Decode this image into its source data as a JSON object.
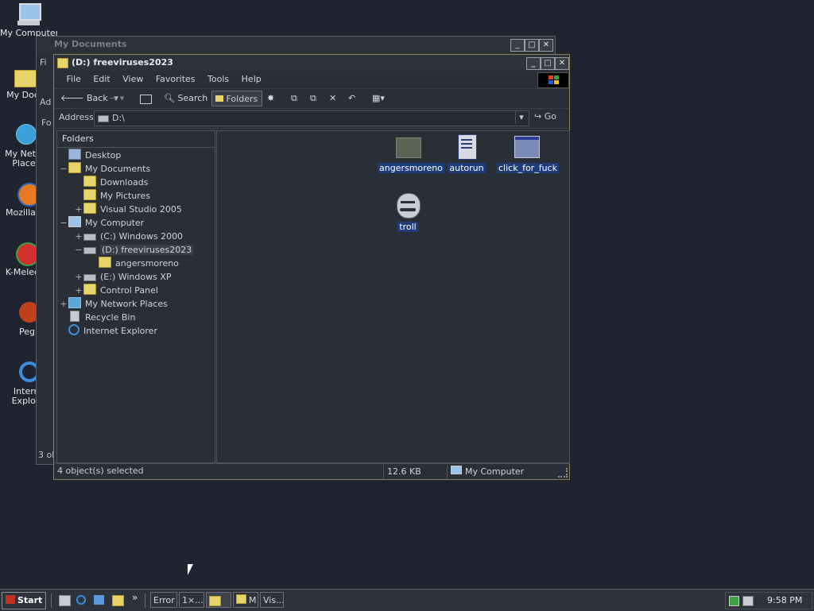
{
  "desktop": {
    "icons": [
      {
        "label": "My Computer"
      },
      {
        "label": "My Docu"
      },
      {
        "label": "My Netw"
      },
      {
        "label": "Place"
      },
      {
        "label": "Mozilla Fi"
      },
      {
        "label": "K-Melec"
      },
      {
        "label": "Peg"
      },
      {
        "label": "Interr"
      },
      {
        "label": "Explor"
      }
    ]
  },
  "bg_window": {
    "title": "My Documents",
    "fragments": [
      "Fi",
      "Ad",
      "Fo",
      "3 ol"
    ]
  },
  "window": {
    "title": "(D:) freeviruses2023",
    "menu": [
      "File",
      "Edit",
      "View",
      "Favorites",
      "Tools",
      "Help"
    ],
    "toolbar": {
      "back": "Back",
      "search": "Search",
      "folders": "Folders"
    },
    "address": {
      "label": "Address",
      "value": "D:\\",
      "go": "Go"
    },
    "folders_header": "Folders",
    "tree": [
      {
        "label": "Desktop",
        "exp": ""
      },
      {
        "label": "My Documents",
        "exp": "−"
      },
      {
        "label": "Downloads",
        "exp": ""
      },
      {
        "label": "My Pictures",
        "exp": ""
      },
      {
        "label": "Visual Studio 2005",
        "exp": "+"
      },
      {
        "label": "My Computer",
        "exp": "−"
      },
      {
        "label": "(C:) Windows 2000",
        "exp": "+"
      },
      {
        "label": "(D:) freeviruses2023",
        "exp": "−"
      },
      {
        "label": "angersmoreno",
        "exp": ""
      },
      {
        "label": "(E:) Windows XP",
        "exp": "+"
      },
      {
        "label": "Control Panel",
        "exp": "+"
      },
      {
        "label": "My Network Places",
        "exp": "+"
      },
      {
        "label": "Recycle Bin",
        "exp": ""
      },
      {
        "label": "Internet Explorer",
        "exp": ""
      }
    ],
    "files": [
      {
        "label": "angersmoreno",
        "icon": "folder-icon"
      },
      {
        "label": "autorun",
        "icon": "text-file-icon"
      },
      {
        "label": "click_for_fuck",
        "icon": "program-window-icon"
      },
      {
        "label": "troll",
        "icon": "troll-face-icon"
      }
    ],
    "status": {
      "selected": "4 object(s) selected",
      "size": "12.6 KB",
      "zone": "My Computer"
    }
  },
  "taskbar": {
    "start": "Start",
    "tasks": [
      "Error",
      "1×...",
      "",
      "M",
      "Vis..."
    ],
    "chevron": "»",
    "time": "9:58 PM"
  },
  "colors": {
    "selection": "#1e3c7a",
    "folder": "#e9d36b",
    "desktop": "#1f2430"
  }
}
